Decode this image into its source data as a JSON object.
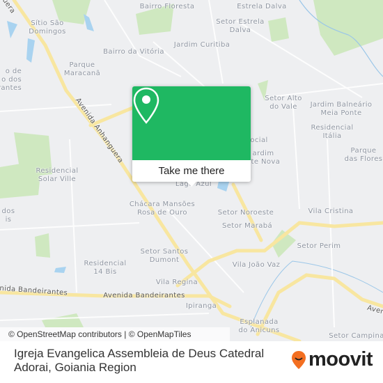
{
  "map": {
    "labels": {
      "bairro_floresta": "Bairro Floresta",
      "estrela_dalva": "Estrela Dalva",
      "setor_estrela_dalva": "Setor Estrela\nDalva",
      "jardim_curitiba": "Jardim Curitiba",
      "sitio_sao_domingos": "Sítio São\nDomingos",
      "bairro_da_vitoria": "Bairro da Vitória",
      "parque_maracana": "Parque\nMaracanã",
      "left_cut_1": "o de\no dos\nrantes",
      "setor_alto_do_vale": "Setor Alto\ndo Vale",
      "jardim_balneario": "Jardim Balneário\nMeia Ponte",
      "residencial_italia": "Residencial\nItália",
      "parque_das_flores": "Parque\ndas Flores",
      "social_cut": "ocial",
      "jardim_nova_cut": "ardim\nnte Nova",
      "residencial_solar_ville": "Residencial\nSolar Ville",
      "lago_azul": "Lago Azul",
      "left_cut_2": "dos\nis",
      "chacara": "Chácara Mansões\nRosa de Ouro",
      "setor_noroeste": "Setor Noroeste",
      "setor_maraba": "Setor Marabá",
      "vila_cristina": "Vila Cristina",
      "setor_perim": "Setor Perim",
      "setor_santos_dumont": "Setor Santos\nDumont",
      "residencial_14_bis": "Residencial\n14 Bis",
      "vila_joao_vaz": "Vila João Vaz",
      "vila_regina": "Vila Regina",
      "ipiranga": "Ipiranga",
      "esplanada": "Esplanada\ndo Anicuns",
      "setor_campina": "Setor Campina"
    },
    "roads": {
      "anhanguera": "Avenida Anhanguera",
      "anhanguera_top": "guera",
      "bandeirantes": "Avenida Bandeirantes",
      "bandeirantes_left": "enida Bandeirantes",
      "right_aven": "Aven"
    },
    "colors": {
      "land": "#eeeff1",
      "road": "#f8e6a0",
      "park": "#cfe8c0",
      "water": "#a9d3f0",
      "popup": "#1fb862"
    }
  },
  "popup": {
    "icon": "map-pin-icon",
    "button_label": "Take me there"
  },
  "attribution": "© OpenStreetMap contributors | © OpenMapTiles",
  "footer": {
    "place_name": "Igreja Evangelica Assembleia de Deus Catedral Adorai, Goiania Region",
    "brand": "moovit"
  }
}
